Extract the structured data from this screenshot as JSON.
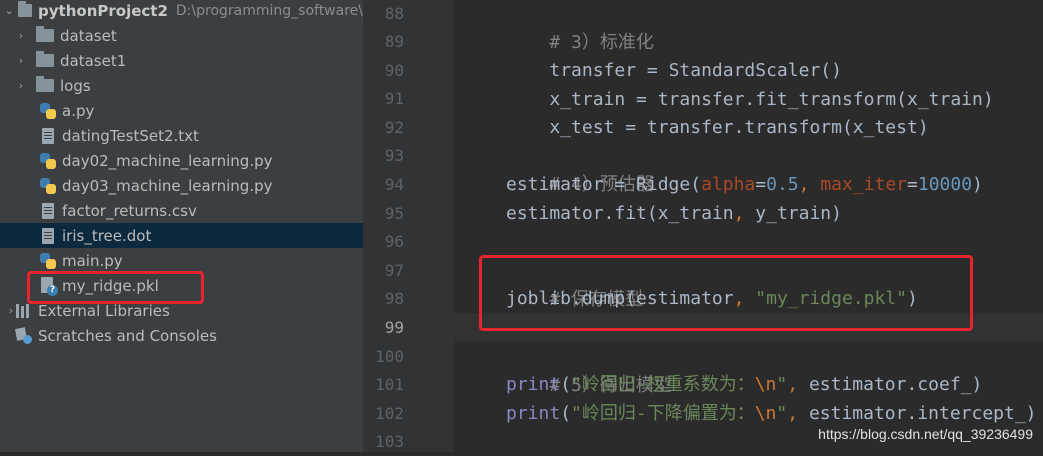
{
  "project_tree": {
    "root": {
      "name": "pythonProject2",
      "path": "D:\\programming_software\\"
    },
    "folders": [
      "dataset",
      "dataset1",
      "logs"
    ],
    "files": [
      "a.py",
      "datingTestSet2.txt",
      "day02_machine_learning.py",
      "day03_machine_learning.py",
      "factor_returns.csv",
      "iris_tree.dot",
      "main.py",
      "my_ridge.pkl"
    ],
    "selected": "iris_tree.dot",
    "external_libraries": "External Libraries",
    "scratches": "Scratches and Consoles"
  },
  "editor": {
    "current_line": "99",
    "line_numbers": [
      "88",
      "89",
      "90",
      "91",
      "92",
      "93",
      "94",
      "95",
      "96",
      "97",
      "98",
      "99",
      "100",
      "101",
      "102",
      "103"
    ],
    "code": {
      "l88": "# 3）标准化",
      "l89": "transfer = StandardScaler()",
      "l90": "x_train = transfer.fit_transform(x_train)",
      "l91": "x_test = transfer.transform(x_test)",
      "l93": "# 4）预估器",
      "l94_a": "estimator = Ridge(",
      "l94_p1": "alpha",
      "l94_b": "=",
      "l94_n1": "0.5",
      "l94_c": ", ",
      "l94_p2": "max_iter",
      "l94_d": "=",
      "l94_n2": "10000",
      "l94_e": ")",
      "l95_a": "estimator.fit(x_train",
      "l95_c": ", ",
      "l95_b": "y_train)",
      "l97": "# 保存模型",
      "l98_a": "joblib.dump(estimator",
      "l98_c": ", ",
      "l98_s": "\"my_ridge.pkl\"",
      "l98_e": ")",
      "l100": "# 5）得出模型",
      "l101_f": "print",
      "l101_a": "(",
      "l101_s": "\"岭回归-权重系数为：",
      "l101_esc": "\\n",
      "l101_q": "\"",
      "l101_c": ", ",
      "l101_b": "estimator.coef_)",
      "l102_f": "print",
      "l102_a": "(",
      "l102_s": "\"岭回归-下降偏置为：",
      "l102_esc": "\\n",
      "l102_q": "\"",
      "l102_c": ", ",
      "l102_b": "estimator.intercept_)"
    }
  },
  "watermark": "https://blog.csdn.net/qq_39236499",
  "colors": {
    "highlight": "#e8242c",
    "keyword": "#cc7832",
    "string": "#6a8759",
    "number": "#6897bb",
    "comment": "#808080",
    "parameter": "#aa4926"
  }
}
